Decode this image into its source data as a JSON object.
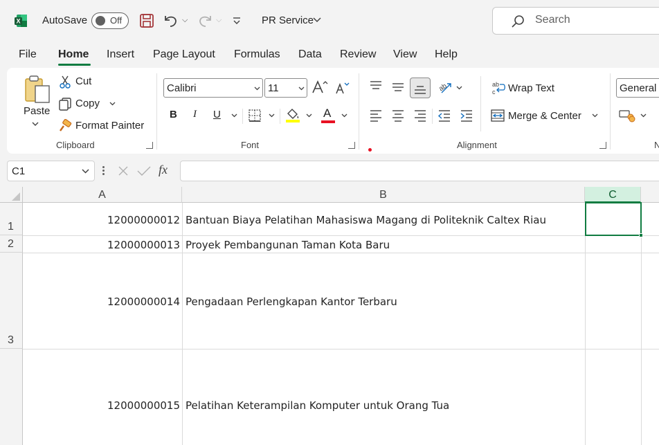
{
  "titlebar": {
    "autosave_label": "AutoSave",
    "autosave_state": "Off",
    "doc_title": "PR Service",
    "search_placeholder": "Search"
  },
  "menu_tabs": [
    "File",
    "Home",
    "Insert",
    "Page Layout",
    "Formulas",
    "Data",
    "Review",
    "View",
    "Help"
  ],
  "active_tab": "Home",
  "ribbon": {
    "clipboard": {
      "paste": "Paste",
      "cut": "Cut",
      "copy": "Copy",
      "format_painter": "Format Painter",
      "group_label": "Clipboard"
    },
    "font": {
      "name": "Calibri",
      "size": "11",
      "bold": "B",
      "italic": "I",
      "underline": "U",
      "font_color_letter": "A",
      "group_label": "Font",
      "fill_color": "#ffff00",
      "font_color": "#e81123"
    },
    "alignment": {
      "wrap_text": "Wrap Text",
      "merge_center": "Merge & Center",
      "group_label": "Alignment"
    },
    "number": {
      "format": "General",
      "group_label_partial": "N"
    }
  },
  "formula_bar": {
    "name_box": "C1",
    "fx": "fx",
    "formula": ""
  },
  "columns": [
    "A",
    "B",
    "C"
  ],
  "rows": [
    {
      "num": "1",
      "a": "12000000012",
      "b": "Bantuan Biaya Pelatihan Mahasiswa Magang di Politeknik Caltex Riau"
    },
    {
      "num": "2",
      "a": "12000000013",
      "b": "Proyek Pembangunan Taman Kota Baru"
    },
    {
      "num": "3",
      "a": "12000000014",
      "b": "Pengadaan Perlengkapan Kantor Terbaru"
    },
    {
      "num": "",
      "a": "12000000015",
      "b": "Pelatihan Keterampilan Komputer untuk Orang Tua"
    }
  ],
  "selected_cell": "C1",
  "colors": {
    "excel_green": "#107c41",
    "selection": "#107c41"
  }
}
